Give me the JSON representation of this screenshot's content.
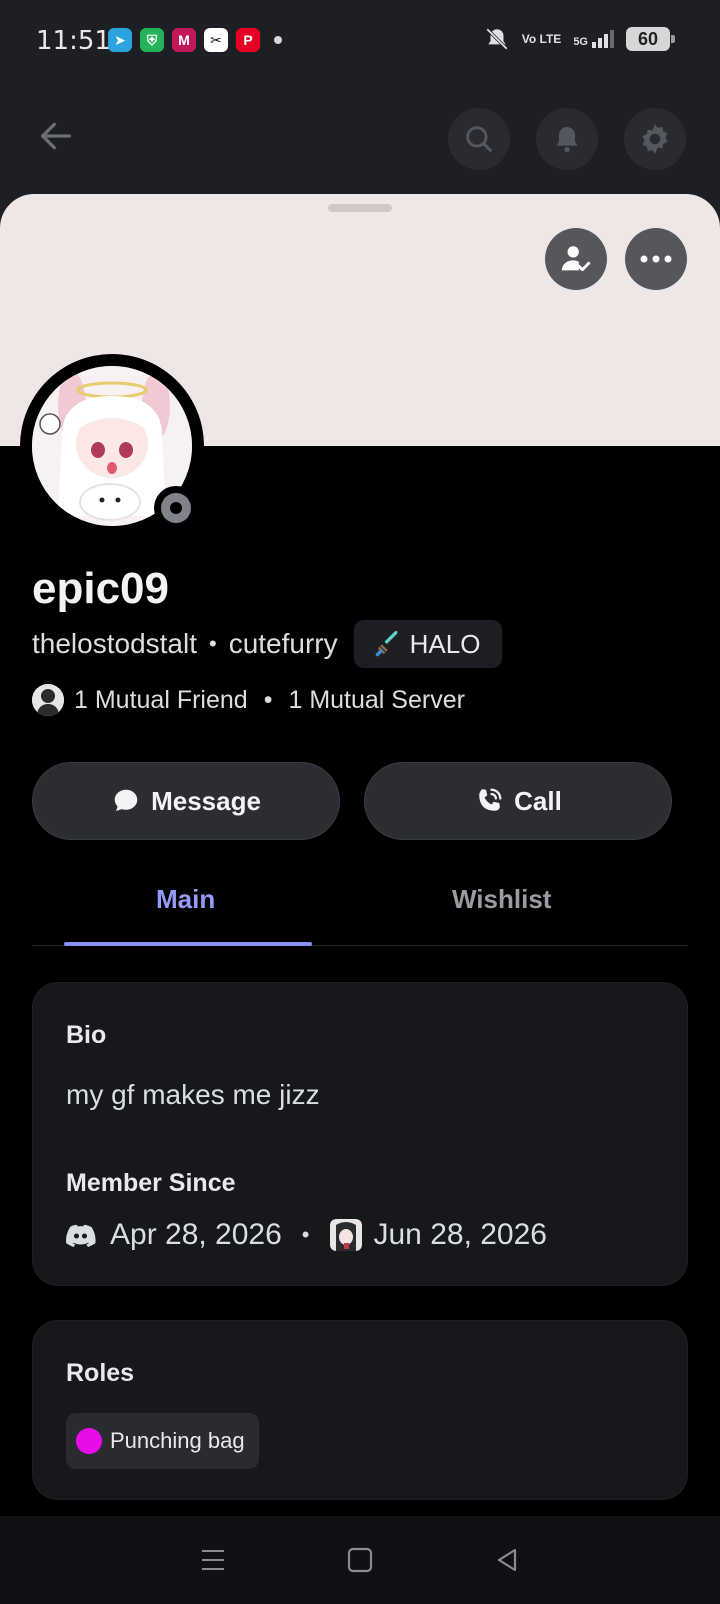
{
  "status_bar": {
    "time": "11:51",
    "notification_apps": [
      {
        "name": "telegram-icon",
        "color": "#2aa3df",
        "glyph": "➤"
      },
      {
        "name": "shield-vpn-icon",
        "color": "#21b25a",
        "glyph": "⛨"
      },
      {
        "name": "mail-app-icon",
        "color": "#c2185b",
        "glyph": "M"
      },
      {
        "name": "capcut-icon",
        "color": "#111111",
        "glyph": "✂"
      },
      {
        "name": "pinterest-icon",
        "color": "#e60023",
        "glyph": "P"
      }
    ],
    "volte": "Vo LTE",
    "network": "5G",
    "battery": "60"
  },
  "profile": {
    "display_name": "epic09",
    "username": "thelostodstalt",
    "pronouns": "cutefurry",
    "tag_label": "HALO",
    "mutual_friends": "1 Mutual Friend",
    "mutual_servers": "1 Mutual Server"
  },
  "actions": {
    "message_label": "Message",
    "call_label": "Call"
  },
  "tabs": {
    "main": "Main",
    "wishlist": "Wishlist"
  },
  "bio_card": {
    "bio_heading": "Bio",
    "bio_text": "my gf makes me jizz",
    "member_since_heading": "Member Since",
    "discord_date": "Apr 28, 2026",
    "server_date": "Jun 28, 2026"
  },
  "roles_card": {
    "heading": "Roles",
    "roles": [
      {
        "name": "Punching bag",
        "color": "#e80ce8"
      }
    ]
  },
  "colors": {
    "accent": "#949cf7",
    "banner": "#efe7e6",
    "card": "#17181c"
  }
}
